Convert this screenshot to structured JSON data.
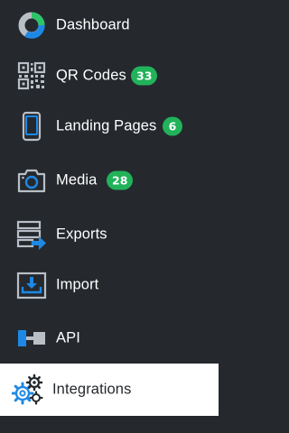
{
  "sidebar": {
    "items": [
      {
        "label": "Dashboard",
        "icon": "dashboard-donut-icon"
      },
      {
        "label": "QR Codes",
        "icon": "qr-code-icon",
        "badge": "33"
      },
      {
        "label": "Landing Pages",
        "icon": "mobile-phone-icon",
        "badge": "6"
      },
      {
        "label": "Media",
        "icon": "camera-icon",
        "badge": "28"
      },
      {
        "label": "Exports",
        "icon": "export-icon"
      },
      {
        "label": "Import",
        "icon": "import-icon"
      },
      {
        "label": "API",
        "icon": "api-icon"
      },
      {
        "label": "Integrations",
        "icon": "integrations-gears-icon",
        "active": true
      }
    ]
  },
  "colors": {
    "background": "#25292e",
    "text": "#ffffff",
    "badge": "#22b35a",
    "accent_blue": "#1e88e5",
    "icon_gray": "#b9bfc7",
    "active_background": "#ffffff",
    "active_text": "#25292e"
  }
}
